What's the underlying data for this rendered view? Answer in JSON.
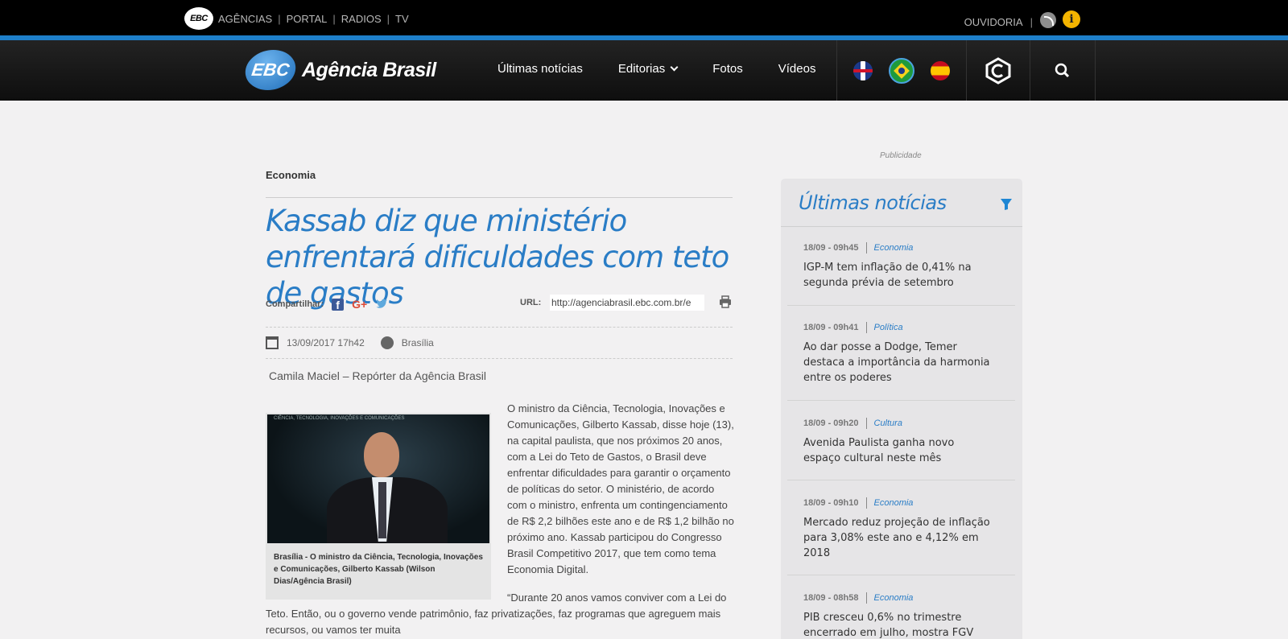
{
  "topbar": {
    "logo": "EBC",
    "links": [
      "AGÊNCIAS",
      "PORTAL",
      "RADIOS",
      "TV"
    ],
    "ouvidoria": "OUVIDORIA"
  },
  "nav": {
    "brand_logo": "EBC",
    "brand_name": "Agência Brasil",
    "menu": [
      "Últimas notícias",
      "Editorias",
      "Fotos",
      "Vídeos"
    ]
  },
  "article": {
    "section": "Economia",
    "title": "Kassab diz que ministério enfrentará dificuldades com teto de gastos",
    "share_label": "Compartilhar:",
    "url_label": "URL:",
    "url_value": "http://agenciabrasil.ebc.com.br/e",
    "date": "13/09/2017 17h42",
    "location": "Brasília",
    "author": "Camila Maciel – Repórter da Agência Brasil",
    "photo_banner": "CIÊNCIA, TECNOLOGIA, INOVAÇÕES E COMUNICAÇÕES",
    "caption": "Brasília - O ministro da Ciência, Tecnologia, Inovações e Comunicações, Gilberto Kassab (Wilson Dias/Agência Brasil)",
    "paragraph1": "O ministro da Ciência, Tecnologia, Inovações e Comunicações, Gilberto Kassab, disse hoje (13), na capital paulista, que nos próximos 20 anos, com a Lei do Teto de Gastos, o Brasil deve enfrentar dificuldades para garantir o orçamento de políticas do setor. O ministério, de acordo com o ministro,  enfrenta um contingenciamento de R$ 2,2 bilhões este ano e de R$ 1,2 bilhão no próximo ano. Kassab participou do Congresso Brasil Competitivo 2017, que tem como tema Economia Digital.",
    "paragraph2": "“Durante 20 anos vamos conviver com a Lei do Teto. Então, ou o governo vende patrimônio, faz privatizações, faz programas que agreguem mais recursos, ou vamos ter muita"
  },
  "sidebar": {
    "publicidade": "Publicidade",
    "title": "Últimas notícias",
    "items": [
      {
        "time": "18/09 - 09h45",
        "category": "Economia",
        "headline": "IGP-M tem inflação de 0,41% na segunda prévia de setembro"
      },
      {
        "time": "18/09 - 09h41",
        "category": "Política",
        "headline": "Ao dar posse a Dodge, Temer destaca a importância da harmonia entre os poderes"
      },
      {
        "time": "18/09 - 09h20",
        "category": "Cultura",
        "headline": "Avenida Paulista ganha novo espaço cultural neste mês"
      },
      {
        "time": "18/09 - 09h10",
        "category": "Economia",
        "headline": "Mercado reduz projeção de inflação para 3,08% este ano e 4,12% em 2018"
      },
      {
        "time": "18/09 - 08h58",
        "category": "Economia",
        "headline": "PIB cresceu 0,6% no trimestre encerrado em julho, mostra FGV"
      }
    ]
  },
  "colors": {
    "accent_blue": "#2a7dc6",
    "strip_blue": "#1e7fc9",
    "topbar": "#000000"
  }
}
